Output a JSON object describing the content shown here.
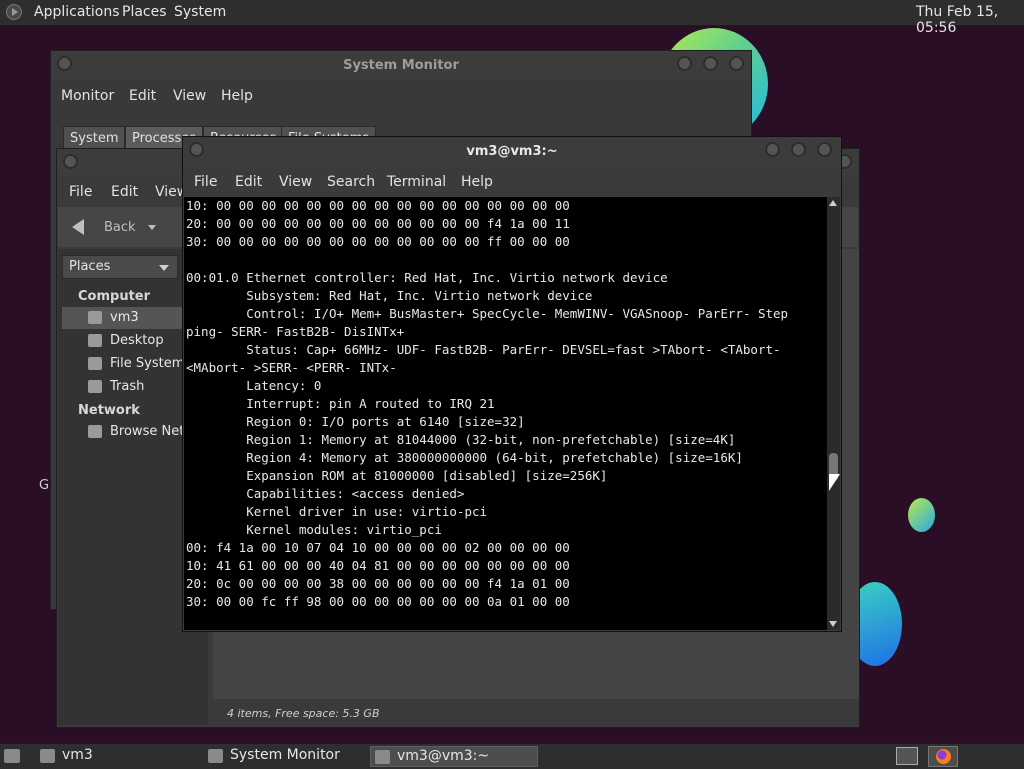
{
  "top_panel": {
    "menus": [
      "Applications",
      "Places",
      "System"
    ],
    "clock": "Thu Feb 15, 05:56"
  },
  "system_monitor": {
    "title": "System Monitor",
    "menu": [
      "Monitor",
      "Edit",
      "View",
      "Help"
    ],
    "tabs": [
      "System",
      "Processes",
      "Resources",
      "File Systems"
    ]
  },
  "file_manager": {
    "menu": [
      "File",
      "Edit",
      "View"
    ],
    "toolbar": {
      "back_label": "Back"
    },
    "places_label": "Places",
    "sidebar": {
      "computer_heading": "Computer",
      "computer_items": [
        "vm3",
        "Desktop",
        "File System",
        "Trash"
      ],
      "network_heading": "Network",
      "network_items": [
        "Browse Net..."
      ]
    },
    "status": "4 items, Free space: 5.3 GB"
  },
  "terminal": {
    "title": "vm3@vm3:~",
    "menu": [
      "File",
      "Edit",
      "View",
      "Search",
      "Terminal",
      "Help"
    ],
    "output": "10: 00 00 00 00 00 00 00 00 00 00 00 00 00 00 00 00\n20: 00 00 00 00 00 00 00 00 00 00 00 00 f4 1a 00 11\n30: 00 00 00 00 00 00 00 00 00 00 00 00 ff 00 00 00\n\n00:01.0 Ethernet controller: Red Hat, Inc. Virtio network device\n        Subsystem: Red Hat, Inc. Virtio network device\n        Control: I/O+ Mem+ BusMaster+ SpecCycle- MemWINV- VGASnoop- ParErr- Step\nping- SERR- FastB2B- DisINTx+\n        Status: Cap+ 66MHz- UDF- FastB2B- ParErr- DEVSEL=fast >TAbort- <TAbort-\n<MAbort- >SERR- <PERR- INTx-\n        Latency: 0\n        Interrupt: pin A routed to IRQ 21\n        Region 0: I/O ports at 6140 [size=32]\n        Region 1: Memory at 81044000 (32-bit, non-prefetchable) [size=4K]\n        Region 4: Memory at 380000000000 (64-bit, prefetchable) [size=16K]\n        Expansion ROM at 81000000 [disabled] [size=256K]\n        Capabilities: <access denied>\n        Kernel driver in use: virtio-pci\n        Kernel modules: virtio_pci\n00: f4 1a 00 10 07 04 10 00 00 00 00 02 00 00 00 00\n10: 41 61 00 00 00 40 04 81 00 00 00 00 00 00 00 00\n20: 0c 00 00 00 00 38 00 00 00 00 00 00 f4 1a 01 00\n30: 00 00 fc ff 98 00 00 00 00 00 00 00 0a 01 00 00"
  },
  "desktop": {
    "partial_label": "G"
  },
  "taskbar": {
    "tasks": [
      "vm3",
      "System Monitor",
      "vm3@vm3:~"
    ]
  },
  "icons": {
    "top_logo": "app-menu-logo-icon",
    "back": "back-arrow-icon",
    "home": "home-folder-icon",
    "desktop": "desktop-icon",
    "filesystem": "drive-icon",
    "trash": "trash-icon",
    "network": "network-icon",
    "show_desktop": "show-desktop-icon",
    "browser": "firefox-icon"
  },
  "colors": {
    "panel": "#2e2e2e",
    "terminal_bg": "#000000",
    "desktop_bg": "#2a0e25"
  }
}
